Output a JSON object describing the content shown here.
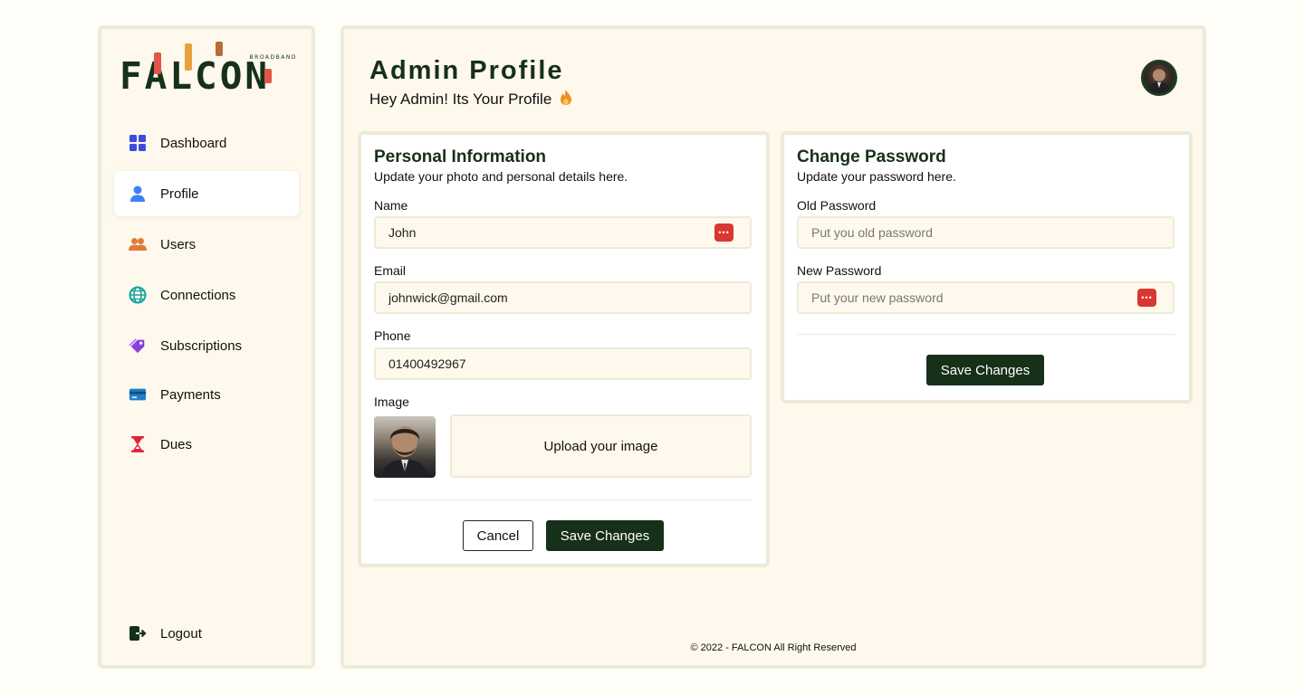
{
  "brand": {
    "name": "FALCON",
    "tagline": "BROADBAND",
    "color": "#16301a"
  },
  "sidebar": {
    "items": [
      {
        "label": "Dashboard",
        "icon": "grid-icon",
        "color": "#3b4de0"
      },
      {
        "label": "Profile",
        "icon": "user-icon",
        "color": "#3b82f6",
        "active": true
      },
      {
        "label": "Users",
        "icon": "users-icon",
        "color": "#e07b39"
      },
      {
        "label": "Connections",
        "icon": "globe-icon",
        "color": "#14a3a0"
      },
      {
        "label": "Subscriptions",
        "icon": "tag-icon",
        "color": "#8b3fe0"
      },
      {
        "label": "Payments",
        "icon": "credit-card-icon",
        "color": "#1d7fc4"
      },
      {
        "label": "Dues",
        "icon": "hourglass-icon",
        "color": "#e0243a"
      }
    ],
    "logout": {
      "label": "Logout",
      "icon": "logout-icon"
    }
  },
  "header": {
    "title": "Admin Profile",
    "subtitle": "Hey Admin! Its Your Profile",
    "subtitle_icon": "fire-icon"
  },
  "personal": {
    "title": "Personal Information",
    "subtitle": "Update your photo and personal details here.",
    "name_label": "Name",
    "name_value": "John",
    "email_label": "Email",
    "email_value": "johnwick@gmail.com",
    "phone_label": "Phone",
    "phone_value": "01400492967",
    "image_label": "Image",
    "upload_label": "Upload your image",
    "cancel_label": "Cancel",
    "save_label": "Save Changes"
  },
  "password": {
    "title": "Change Password",
    "subtitle": "Update your password here.",
    "old_label": "Old Password",
    "old_placeholder": "Put you old password",
    "new_label": "New Password",
    "new_placeholder": "Put your new password",
    "save_label": "Save Changes"
  },
  "footer": {
    "text": "© 2022 - FALCON All Right Reserved"
  }
}
